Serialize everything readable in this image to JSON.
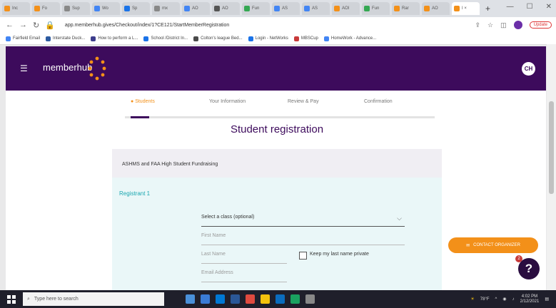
{
  "browser": {
    "tabs": [
      {
        "label": "Inc",
        "color": "#f39019"
      },
      {
        "label": "Fo",
        "color": "#f39019"
      },
      {
        "label": "Sup",
        "color": "#888888"
      },
      {
        "label": "Wo",
        "color": "#4285f4"
      },
      {
        "label": "Sp",
        "color": "#1a73e8"
      },
      {
        "label": "mx",
        "color": "#888888"
      },
      {
        "label": "AO",
        "color": "#4285f4"
      },
      {
        "label": "AO",
        "color": "#555555"
      },
      {
        "label": "Fun",
        "color": "#34a853"
      },
      {
        "label": "AS",
        "color": "#4285f4"
      },
      {
        "label": "AS",
        "color": "#4285f4"
      },
      {
        "label": "AOI",
        "color": "#f39019"
      },
      {
        "label": "Fun",
        "color": "#34a853"
      },
      {
        "label": "Rar",
        "color": "#f39019"
      },
      {
        "label": "AO",
        "color": "#f39019"
      },
      {
        "label": "I ×",
        "color": "#f39019",
        "active": true
      }
    ],
    "new_tab": "+",
    "url": "app.memberhub.gives/Checkout/index/1?CE121/StartMemberRegistration",
    "update_label": "Update",
    "bookmarks": [
      {
        "label": "Fairfield Email",
        "color": "#4285f4"
      },
      {
        "label": "Interstate Duck...",
        "color": "#2c5aa0"
      },
      {
        "label": "How to perform a L...",
        "color": "#3d3d8c"
      },
      {
        "label": "School /District In...",
        "color": "#1a73e8"
      },
      {
        "label": "Colton's league Bed...",
        "color": "#4a4a4a"
      },
      {
        "label": "Login - NetWorks",
        "color": "#1a73e8"
      },
      {
        "label": "MBSCup",
        "color": "#c83a3a"
      },
      {
        "label": "HomeWork - Advance...",
        "color": "#4285f4"
      }
    ]
  },
  "header": {
    "logo_text": "memberhub",
    "avatar_initials": "CH"
  },
  "steps": [
    {
      "label": "Students",
      "active": true
    },
    {
      "label": "Your Information"
    },
    {
      "label": "Review & Pay"
    },
    {
      "label": "Confirmation"
    }
  ],
  "page": {
    "title": "Student registration",
    "org_name": "ASHMS and FAA High Student Fundraising",
    "registrant_label": "Registrant 1",
    "class_select": "Select a class (optional)",
    "first_name_placeholder": "First Name",
    "last_name_placeholder": "Last Name",
    "keep_private_label": "Keep my last name private",
    "email_placeholder": "Email Address"
  },
  "widgets": {
    "contact_label": "CONTACT ORGANIZER",
    "help_symbol": "?",
    "help_badge": "2"
  },
  "taskbar": {
    "search_placeholder": "Type here to search",
    "weather": "78°F",
    "time": "4:02 PM",
    "date": "2/12/2021",
    "apps": [
      "#4a90d9",
      "#3a7bd5",
      "#0078d4",
      "#2b5797",
      "#e04a3f",
      "#f4c20d",
      "#0b6cbd",
      "#1aa260",
      "#888888"
    ]
  }
}
